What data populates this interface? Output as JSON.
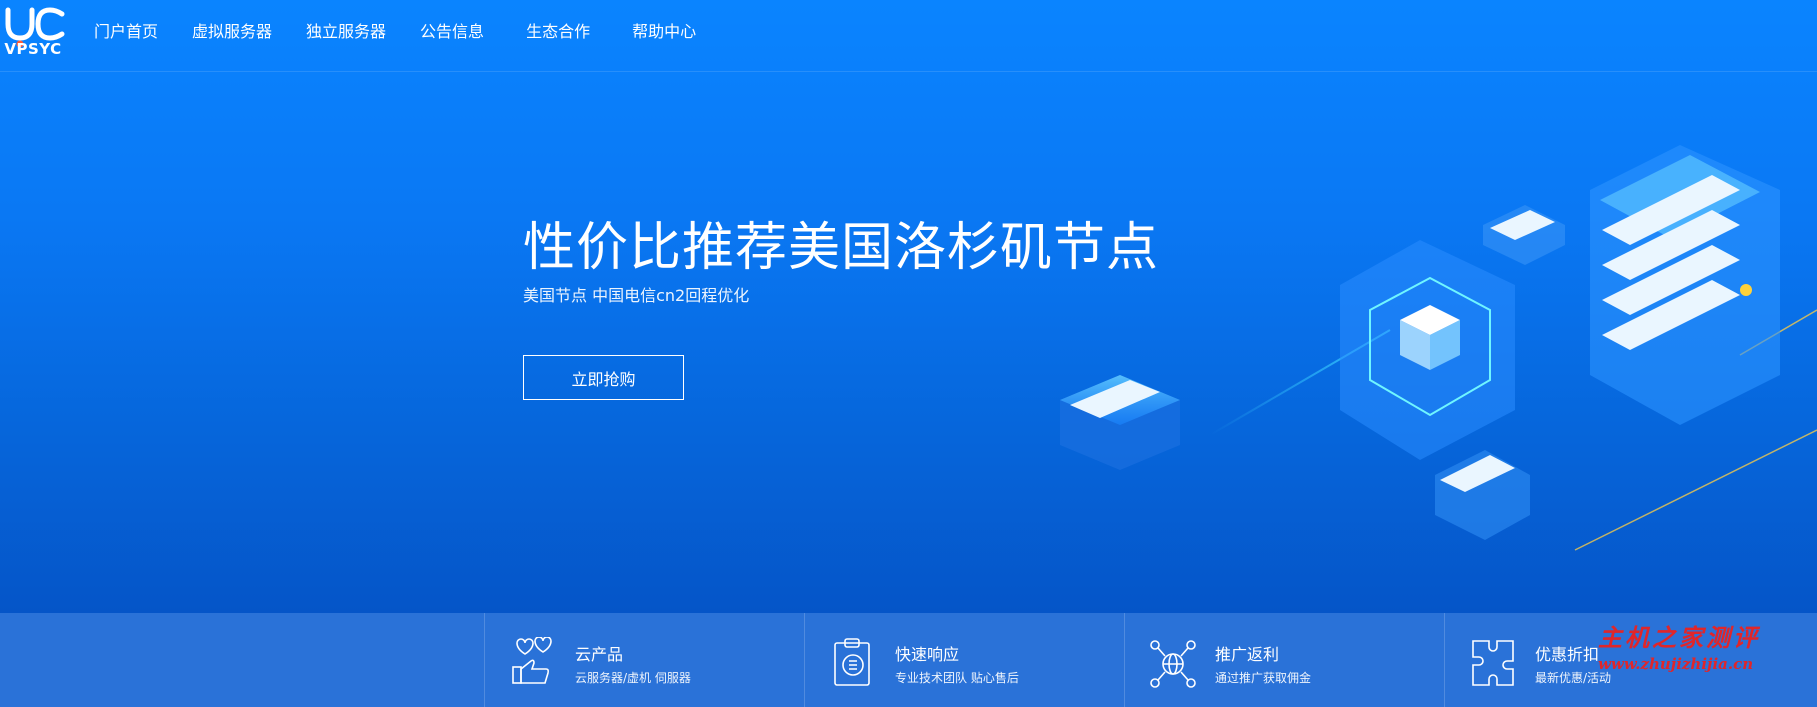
{
  "brand": {
    "logo_text": "VPSYC",
    "logo_color": "#ffffff",
    "logo_dot_color": "#ff5a36"
  },
  "nav": {
    "items": [
      {
        "label": "门户首页"
      },
      {
        "label": "虚拟服务器"
      },
      {
        "label": "独立服务器"
      },
      {
        "label": "公告信息"
      },
      {
        "label": "生态合作"
      },
      {
        "label": "帮助中心"
      }
    ]
  },
  "hero": {
    "title": "性价比推荐美国洛杉矶节点",
    "subtitle": "美国节点 中国电信cn2回程优化",
    "cta_label": "立即抢购"
  },
  "features": [
    {
      "icon": "cloud-product-icon",
      "title": "云产品",
      "desc": "云服务器/虚机 伺服器"
    },
    {
      "icon": "clipboard-icon",
      "title": "快速响应",
      "desc": "专业技术团队 贴心售后"
    },
    {
      "icon": "network-globe-icon",
      "title": "推广返利",
      "desc": "通过推广获取佣金"
    },
    {
      "icon": "puzzle-icon",
      "title": "优惠折扣",
      "desc": "最新优惠/活动"
    }
  ],
  "watermark": {
    "line1": "主机之家测评",
    "line2": "www.zhujizhijia.cn"
  },
  "colors": {
    "accent": "#0a84ff",
    "feature_bar": "#2a72d8",
    "watermark": "#e0262a"
  }
}
